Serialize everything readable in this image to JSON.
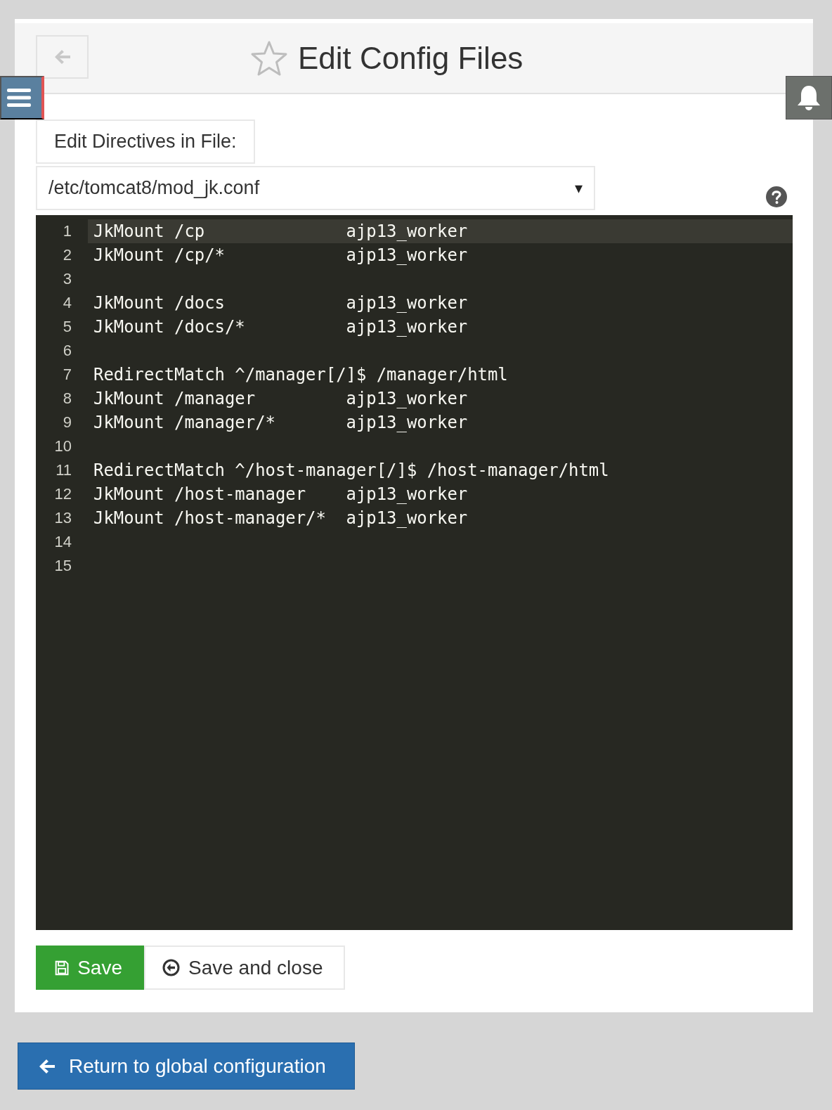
{
  "header": {
    "title": "Edit Config Files"
  },
  "file_label": "Edit Directives in File:",
  "file_select": {
    "value": "/etc/tomcat8/mod_jk.conf",
    "arrow": "▾"
  },
  "editor": {
    "lines": [
      {
        "number": "1",
        "text": "JkMount /cp              ajp13_worker",
        "active": true
      },
      {
        "number": "2",
        "text": "JkMount /cp/*            ajp13_worker",
        "active": false
      },
      {
        "number": "3",
        "active": false
      },
      {
        "number": "4",
        "text": "JkMount /docs            ajp13_worker",
        "active": false
      },
      {
        "number": "5",
        "text": "JkMount /docs/*          ajp13_worker",
        "active": false
      },
      {
        "number": "6",
        "active": false
      },
      {
        "number": "7",
        "text": "RedirectMatch ^/manager[/]$ /manager/html",
        "active": false
      },
      {
        "number": "8",
        "text": "JkMount /manager         ajp13_worker",
        "active": false
      },
      {
        "number": "9",
        "text": "JkMount /manager/*       ajp13_worker",
        "active": false
      },
      {
        "number": "10",
        "active": false
      },
      {
        "number": "11",
        "text": "RedirectMatch ^/host-manager[/]$ /host-manager/html",
        "active": false
      },
      {
        "number": "12",
        "text": "JkMount /host-manager    ajp13_worker",
        "active": false
      },
      {
        "number": "13",
        "text": "JkMount /host-manager/*  ajp13_worker",
        "active": false
      },
      {
        "number": "14",
        "active": false
      },
      {
        "number": "15",
        "active": false
      }
    ]
  },
  "actions": [
    {
      "kind": "primary",
      "label": "Save"
    },
    {
      "kind": "secondary",
      "label": "Save and close"
    }
  ],
  "return_button": {
    "label": "Return to global configuration"
  }
}
